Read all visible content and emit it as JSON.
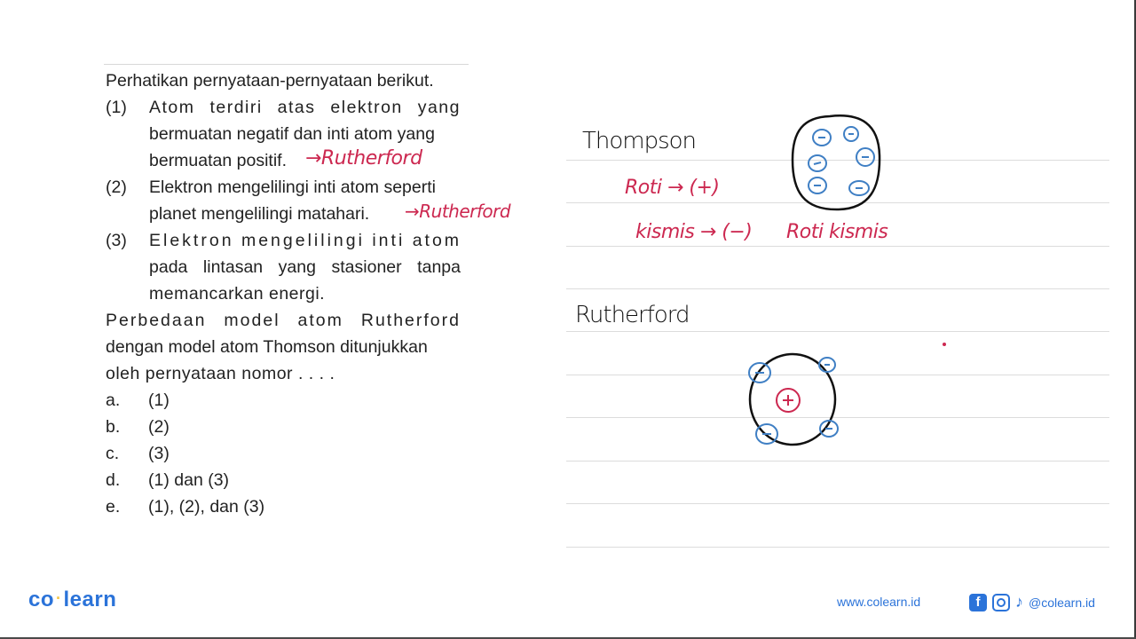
{
  "question": {
    "intro": "Perhatikan pernyataan-pernyataan berikut.",
    "statements": [
      {
        "number": "(1)",
        "lines": [
          "Atom terdiri atas elektron yang",
          "bermuatan negatif dan inti atom yang",
          "bermuatan positif."
        ],
        "annotation": "→Rutherford"
      },
      {
        "number": "(2)",
        "lines": [
          "Elektron mengelilingi inti atom seperti",
          "planet mengelilingi matahari."
        ],
        "annotation": "→Rutherford"
      },
      {
        "number": "(3)",
        "lines": [
          "Elektron mengelilingi inti atom",
          "pada lintasan yang stasioner tanpa",
          "memancarkan energi."
        ],
        "annotation": ""
      }
    ],
    "prompt_lines": [
      "Perbedaan model atom Rutherford",
      "dengan model atom Thomson ditunjukkan",
      "oleh pernyataan nomor . . . ."
    ],
    "options": [
      {
        "letter": "a.",
        "text": "(1)"
      },
      {
        "letter": "b.",
        "text": "(2)"
      },
      {
        "letter": "c.",
        "text": "(3)"
      },
      {
        "letter": "d.",
        "text": "(1) dan (3)"
      },
      {
        "letter": "e.",
        "text": "(1), (2), dan (3)"
      }
    ]
  },
  "notes": {
    "thomson_title": "Thompson",
    "roti_line": "Roti → (+)",
    "kismis_line": "kismis → (−)",
    "roti_kismis": "Roti kismis",
    "rutherford_title": "Rutherford",
    "thomson_electron_symbol": "−",
    "rutherford_electron_symbol": "−",
    "nucleus_symbol": "+"
  },
  "colors": {
    "annotation_red": "#cc2850",
    "electron_blue": "#3f7fc4",
    "brand_blue": "#2b73d9"
  },
  "footer": {
    "logo_left": "co",
    "logo_dot": "·",
    "logo_right": "learn",
    "website": "www.colearn.id",
    "facebook_icon": "f",
    "tiktok_icon": "♪",
    "handle": "@colearn.id"
  }
}
